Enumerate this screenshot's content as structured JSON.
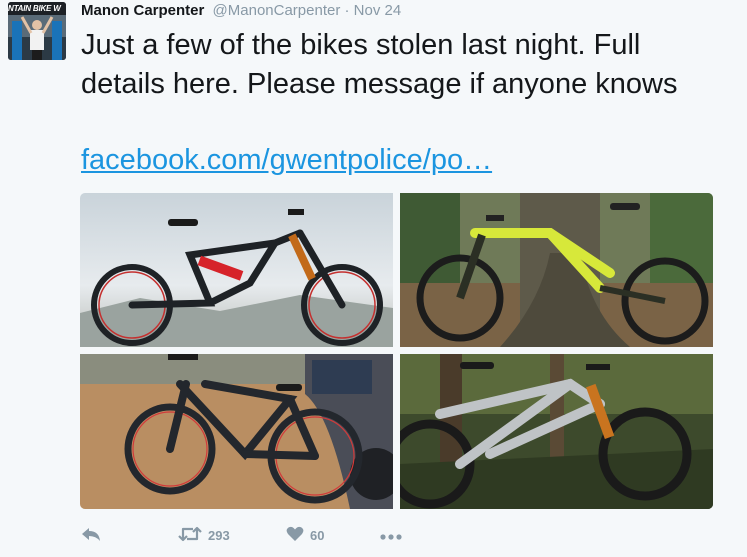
{
  "tweet": {
    "avatar": {
      "banner_text": "NTAIN BIKE W"
    },
    "author_name": "Manon Carpenter",
    "author_handle": "@ManonCarpenter",
    "separator": "·",
    "date": "Nov 24",
    "text": "Just a few of the bikes stolen last night. Full details here. Please message if anyone knows",
    "link_text": "facebook.com/gwentpolice/po…",
    "media": [
      {
        "name": "bike-photo-1",
        "bike_color": "#1e2226",
        "accent": "#d6232a"
      },
      {
        "name": "bike-photo-2",
        "bike_color": "#d7e83a",
        "accent": "#2b2f24"
      },
      {
        "name": "bike-photo-3",
        "bike_color": "#23272d",
        "accent": "#3a3f47"
      },
      {
        "name": "bike-photo-4",
        "bike_color": "#bfc3c6",
        "accent": "#c9741f"
      }
    ],
    "actions": {
      "reply_icon": "reply-icon",
      "retweet_icon": "retweet-icon",
      "retweet_count": "293",
      "like_icon": "heart-icon",
      "like_count": "60",
      "more_icon": "more-icon"
    },
    "colors": {
      "link": "#1b95e0",
      "muted": "#8899a6",
      "text": "#14171a",
      "background": "#f5f8fa"
    }
  }
}
